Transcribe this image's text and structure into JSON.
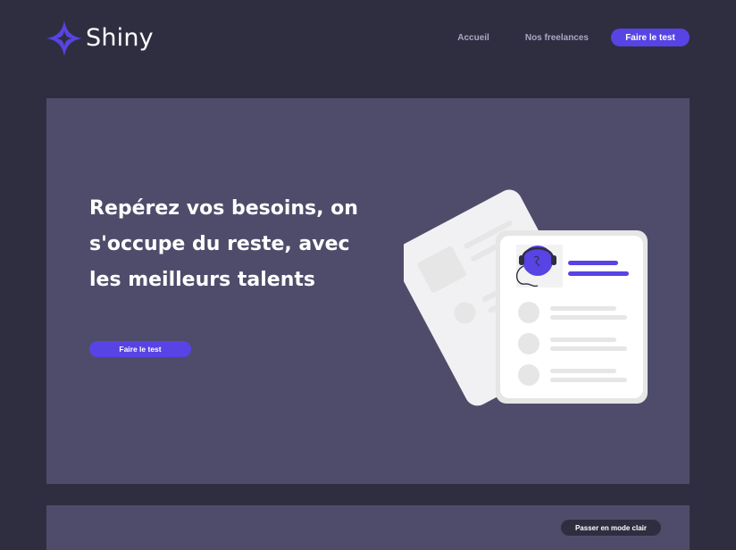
{
  "brand": {
    "name": "Shiny",
    "accent": "#5843e4"
  },
  "nav": {
    "home_label": "Accueil",
    "freelances_label": "Nos freelances",
    "test_label": "Faire le test"
  },
  "hero": {
    "title": "Repérez vos besoins, on s'occupe du reste, avec les meilleurs talents",
    "cta_label": "Faire le test"
  },
  "footer": {
    "mode_toggle_label": "Passer en mode clair"
  }
}
